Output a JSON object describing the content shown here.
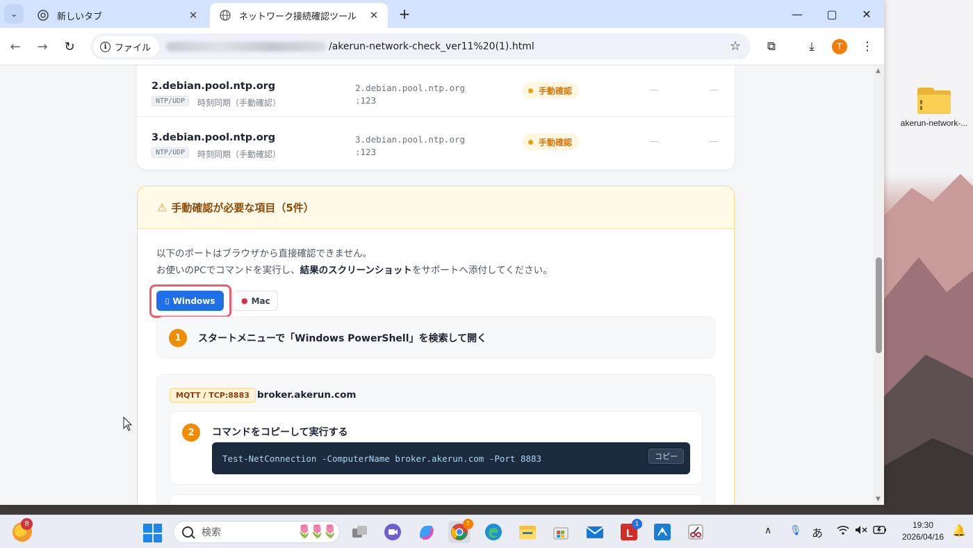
{
  "browser": {
    "tabs": [
      {
        "title": "新しいタブ",
        "active": false
      },
      {
        "title": "ネットワーク接続確認ツール",
        "active": true
      }
    ],
    "address_chip": "ファイル",
    "url_visible": "/akerun-network-check_ver11%20(1).html",
    "profile_initial": "T"
  },
  "ntp_rows": [
    {
      "name": "2.debian.pool.ntp.org",
      "protocol": "NTP/UDP",
      "purpose": "時刻同期（手動確認）",
      "host_line1": "2.debian.pool.ntp.org",
      "host_line2": ":123",
      "status": "手動確認",
      "col1": "—",
      "col2": "—"
    },
    {
      "name": "3.debian.pool.ntp.org",
      "protocol": "NTP/UDP",
      "purpose": "時刻同期（手動確認）",
      "host_line1": "3.debian.pool.ntp.org",
      "host_line2": ":123",
      "status": "手動確認",
      "col1": "—",
      "col2": "—"
    }
  ],
  "manual": {
    "title": "手動確認が必要な項目（5件）",
    "line1": "以下のポートはブラウザから直接確認できません。",
    "line2_prefix": "お使いのPCでコマンドを実行し、",
    "line2_bold": "結果のスクリーンショット",
    "line2_suffix": "をサポートへ添付してください。",
    "os_tabs": {
      "windows": "Windows",
      "mac": "Mac"
    },
    "step1": {
      "num": "1",
      "text": "スタートメニューで「Windows PowerShell」を検索して開く"
    },
    "port_block": {
      "tag": "MQTT / TCP:8883",
      "host": "broker.akerun.com",
      "step2": {
        "num": "2",
        "text": "コマンドをコピーして実行する"
      },
      "command": "Test-NetConnection -ComputerName broker.akerun.com -Port 8883",
      "copy_label": "コピー"
    }
  },
  "desktop": {
    "icon_label": "akerun-network-..."
  },
  "taskbar": {
    "weather_badge": "8",
    "search_placeholder": "検索",
    "chrome_badge": "T",
    "lastpass_badge": "1",
    "ime": "あ",
    "time": "19:30",
    "date": "2026/04/16"
  },
  "colors": {
    "accent_blue": "#1f6fe8",
    "warning_orange": "#f08c00",
    "highlight_red": "#ef5b6b",
    "code_bg": "#1c2a3e"
  }
}
